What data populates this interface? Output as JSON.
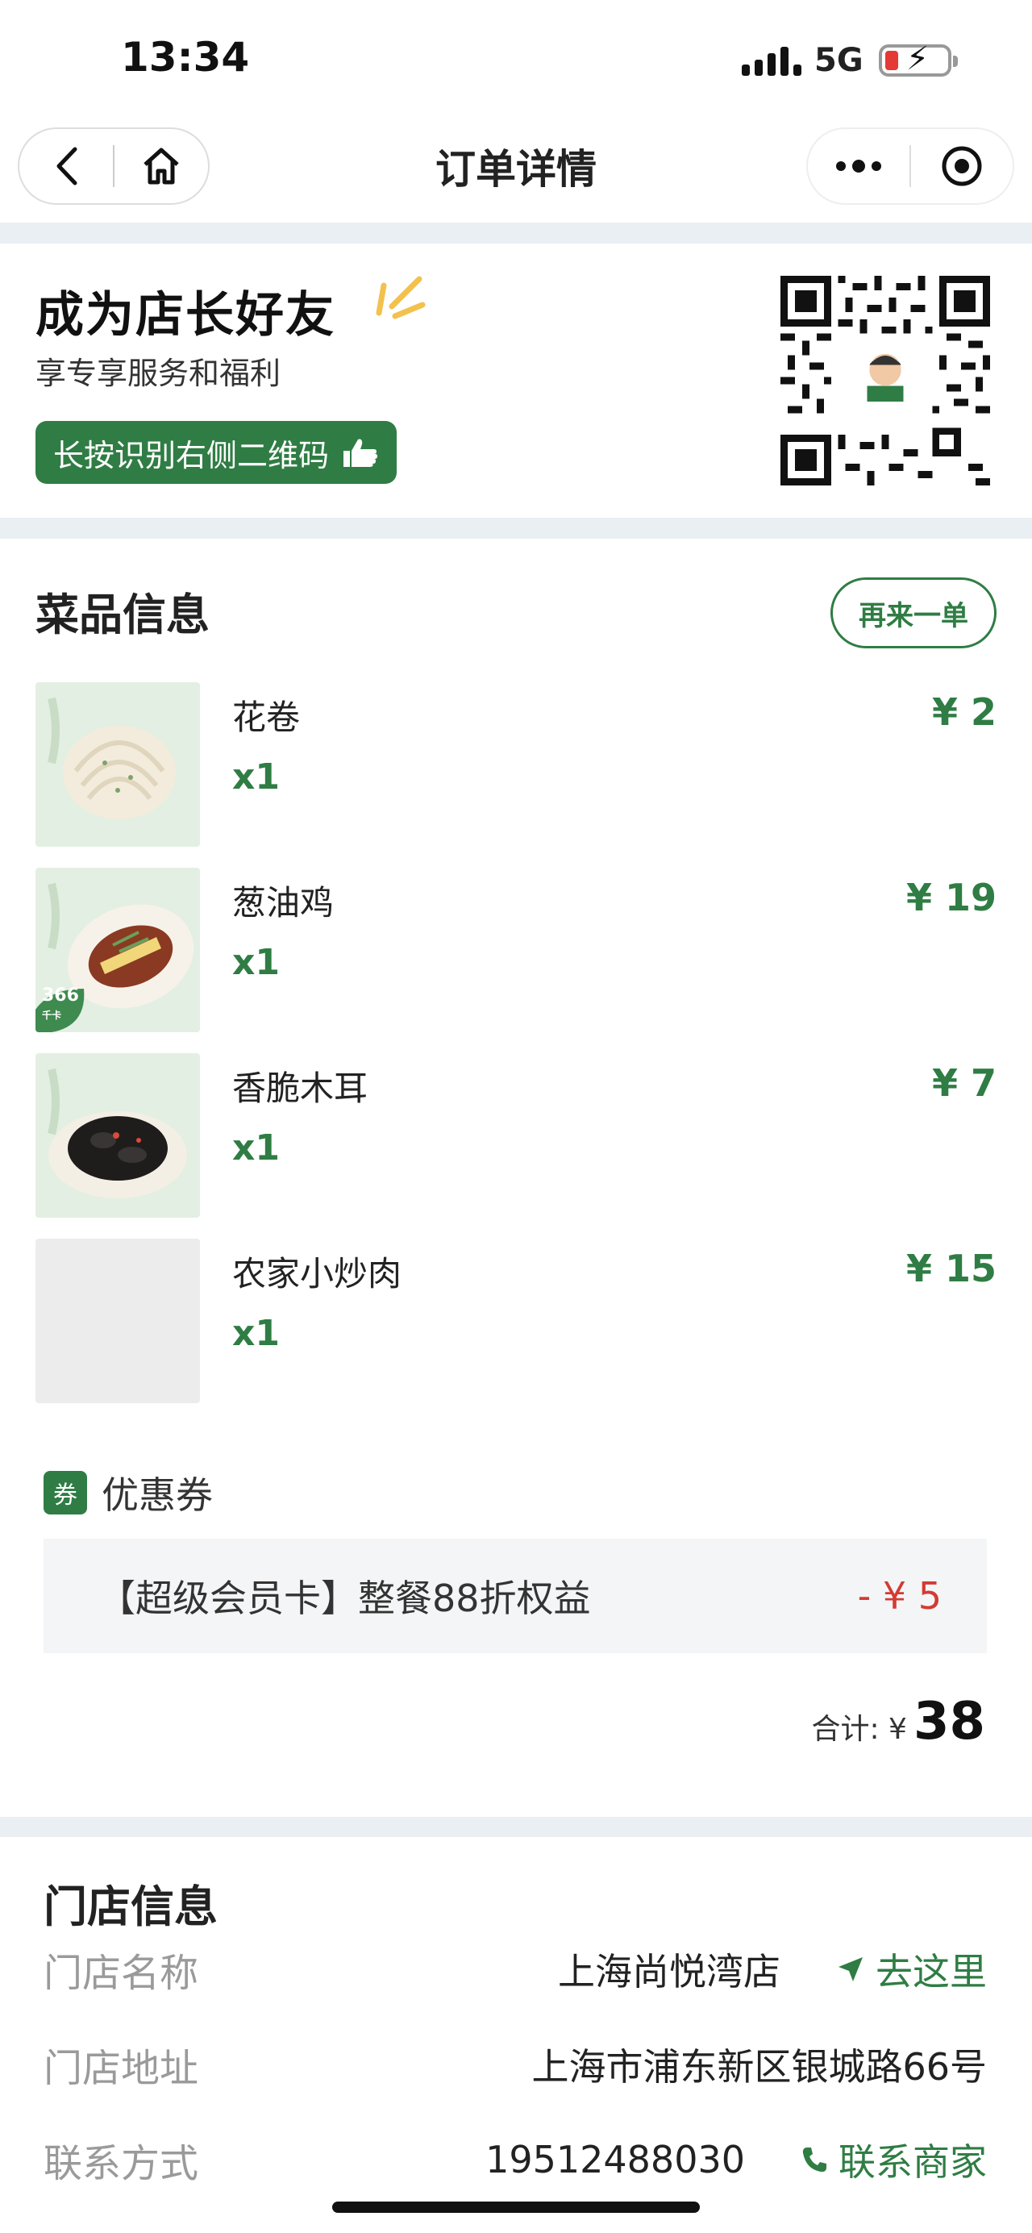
{
  "status_bar": {
    "time": "13:34",
    "network": "5G"
  },
  "nav": {
    "title": "订单详情"
  },
  "promo": {
    "title": "成为店长好友",
    "subtitle": "享专享服务和福利",
    "button_label": "长按识别右侧二维码"
  },
  "dishes": {
    "section_title": "菜品信息",
    "reorder_label": "再来一单",
    "items": [
      {
        "name": "花卷",
        "qty": "x1",
        "price": "¥ 2"
      },
      {
        "name": "葱油鸡",
        "qty": "x1",
        "price": "¥ 19",
        "badge": "366",
        "badge_sub": "千卡"
      },
      {
        "name": "香脆木耳",
        "qty": "x1",
        "price": "¥ 7"
      },
      {
        "name": "农家小炒肉",
        "qty": "x1",
        "price": "¥ 15"
      }
    ]
  },
  "coupon": {
    "tag": "券",
    "label": "优惠券",
    "name": "【超级会员卡】整餐88折权益",
    "discount": "- ¥ 5"
  },
  "total": {
    "label": "合计: ¥",
    "amount": "38"
  },
  "store": {
    "section_title": "门店信息",
    "name_label": "门店名称",
    "name": "上海尚悦湾店",
    "navigate_label": "去这里",
    "address_label": "门店地址",
    "address": "上海市浦东新区银城路66号",
    "contact_label": "联系方式",
    "phone": "19512488030",
    "call_label": "联系商家"
  },
  "colors": {
    "accent": "#2f7d44",
    "discount": "#d33b33",
    "page_bg": "#e9eff2"
  }
}
